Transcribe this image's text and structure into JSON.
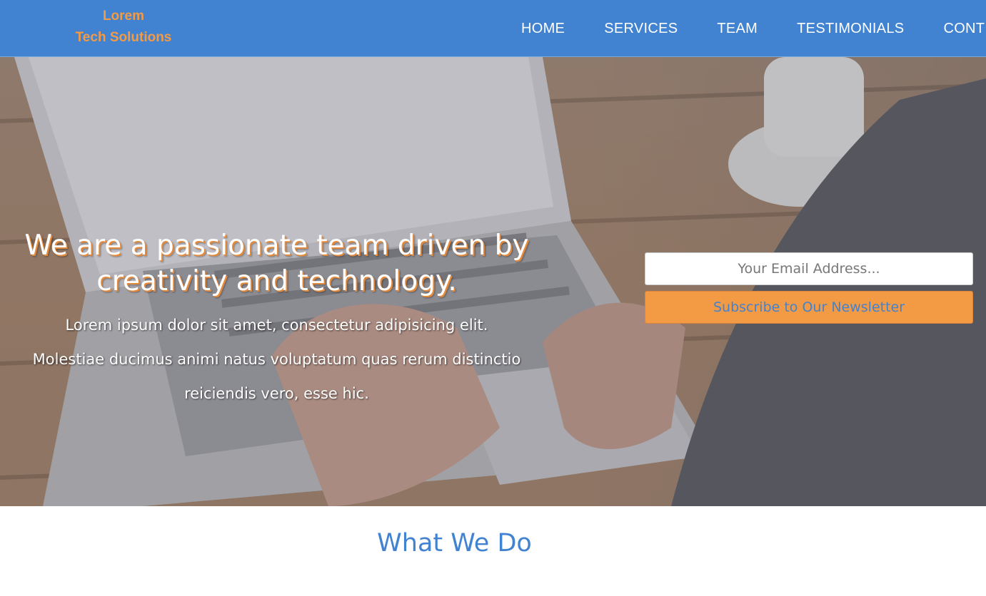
{
  "brand": {
    "line1": "Lorem",
    "line2": "Tech Solutions",
    "color": "#f39a45"
  },
  "nav": {
    "background": "#4183d0",
    "items": [
      {
        "label": "HOME"
      },
      {
        "label": "SERVICES"
      },
      {
        "label": "TEAM"
      },
      {
        "label": "TESTIMONIALS"
      },
      {
        "label": "CONT"
      }
    ]
  },
  "hero": {
    "title": "We are a passionate team driven by creativity and technology.",
    "subtitle": "Lorem ipsum dolor sit amet, consectetur adipisicing elit. Molestiae ducimus animi natus voluptatum quas rerum distinctio reiciendis vero, esse hic.",
    "newsletter": {
      "email_placeholder": "Your Email Address...",
      "subscribe_label": "Subscribe to Our Newsletter",
      "button_color": "#f39a45"
    }
  },
  "section": {
    "title": "What We Do"
  }
}
